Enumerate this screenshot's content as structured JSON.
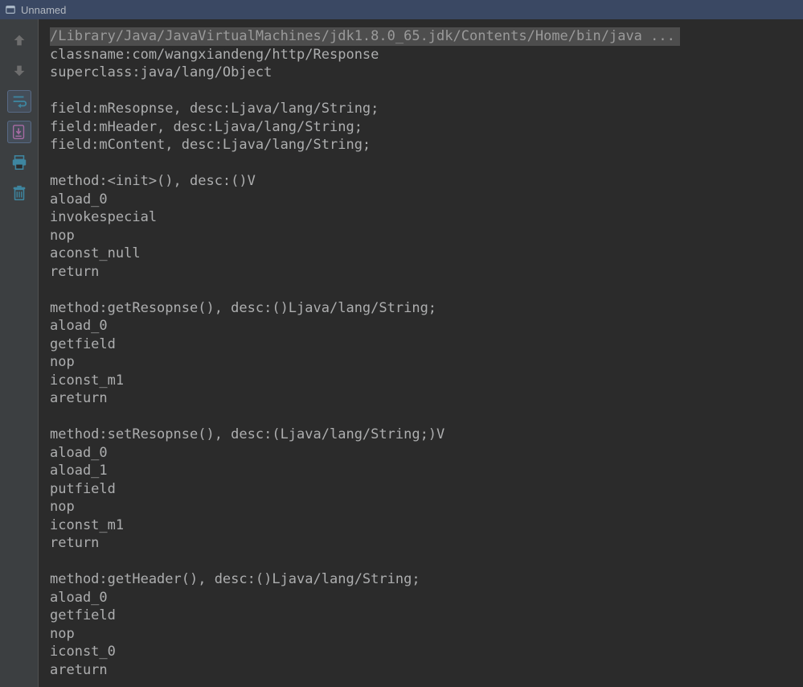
{
  "window": {
    "title": "Unnamed"
  },
  "toolbar": {
    "icons": [
      "arrow-up-icon",
      "arrow-down-icon",
      "wrap-text-icon",
      "scroll-to-end-icon",
      "print-icon",
      "trash-icon"
    ]
  },
  "console": {
    "header": "/Library/Java/JavaVirtualMachines/jdk1.8.0_65.jdk/Contents/Home/bin/java ...",
    "lines": [
      "classname:com/wangxiandeng/http/Response",
      "superclass:java/lang/Object",
      "",
      "field:mResopnse, desc:Ljava/lang/String;",
      "field:mHeader, desc:Ljava/lang/String;",
      "field:mContent, desc:Ljava/lang/String;",
      "",
      "method:<init>(), desc:()V",
      "aload_0",
      "invokespecial",
      "nop",
      "aconst_null",
      "return",
      "",
      "method:getResopnse(), desc:()Ljava/lang/String;",
      "aload_0",
      "getfield",
      "nop",
      "iconst_m1",
      "areturn",
      "",
      "method:setResopnse(), desc:(Ljava/lang/String;)V",
      "aload_0",
      "aload_1",
      "putfield",
      "nop",
      "iconst_m1",
      "return",
      "",
      "method:getHeader(), desc:()Ljava/lang/String;",
      "aload_0",
      "getfield",
      "nop",
      "iconst_0",
      "areturn"
    ]
  }
}
